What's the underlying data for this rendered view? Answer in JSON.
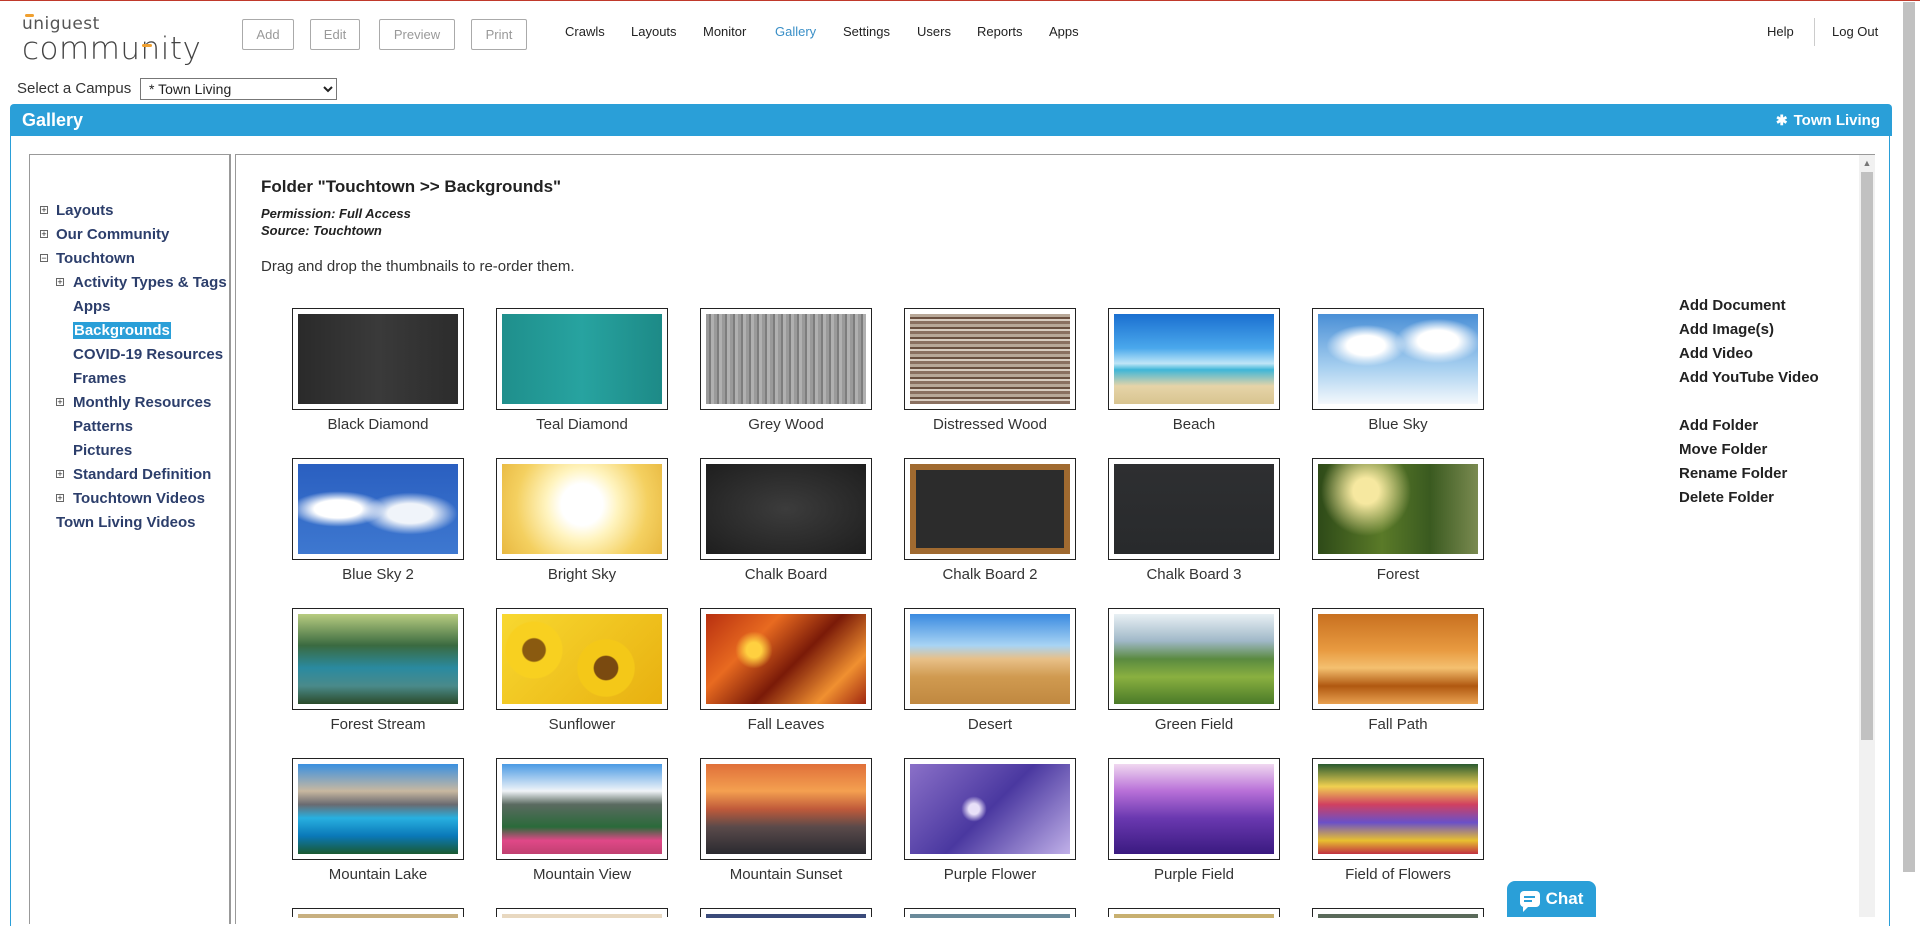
{
  "logo": {
    "line1": "uniguest",
    "line2": "community"
  },
  "toolbar": {
    "add": "Add",
    "edit": "Edit",
    "preview": "Preview",
    "print": "Print"
  },
  "nav": [
    {
      "label": "Crawls",
      "active": false
    },
    {
      "label": "Layouts",
      "active": false
    },
    {
      "label": "Monitor",
      "active": false
    },
    {
      "label": "Gallery",
      "active": true
    },
    {
      "label": "Settings",
      "active": false
    },
    {
      "label": "Users",
      "active": false
    },
    {
      "label": "Reports",
      "active": false
    },
    {
      "label": "Apps",
      "active": false
    }
  ],
  "header_right": {
    "help": "Help",
    "logout": "Log Out"
  },
  "campus": {
    "label": "Select a Campus",
    "selected": "* Town Living"
  },
  "gallery_bar": {
    "title": "Gallery",
    "campus": "Town Living"
  },
  "tree": [
    {
      "label": "Layouts",
      "expander": "+",
      "selected": false
    },
    {
      "label": "Our Community",
      "expander": "+",
      "selected": false
    },
    {
      "label": "Touchtown",
      "expander": "−",
      "selected": false
    },
    {
      "label": "Activity Types & Tags",
      "expander": "+",
      "selected": false
    },
    {
      "label": "Apps",
      "expander": "",
      "selected": false
    },
    {
      "label": "Backgrounds",
      "expander": "",
      "selected": true
    },
    {
      "label": "COVID-19 Resources",
      "expander": "",
      "selected": false
    },
    {
      "label": "Frames",
      "expander": "",
      "selected": false
    },
    {
      "label": "Monthly Resources",
      "expander": "+",
      "selected": false
    },
    {
      "label": "Patterns",
      "expander": "",
      "selected": false
    },
    {
      "label": "Pictures",
      "expander": "",
      "selected": false
    },
    {
      "label": "Standard Definition",
      "expander": "+",
      "selected": false
    },
    {
      "label": "Touchtown Videos",
      "expander": "+",
      "selected": false
    },
    {
      "label": "Town Living Videos",
      "expander": "",
      "selected": false
    }
  ],
  "folder": {
    "title": "Folder  \"Touchtown >> Backgrounds\"",
    "permission": "Permission: Full Access",
    "source": "Source: Touchtown",
    "hint": "Drag and drop the thumbnails to re-order them."
  },
  "thumbnails": [
    "Black Diamond",
    "Teal Diamond",
    "Grey Wood",
    "Distressed Wood",
    "Beach",
    "Blue Sky",
    "Blue Sky 2",
    "Bright Sky",
    "Chalk Board",
    "Chalk Board 2",
    "Chalk Board 3",
    "Forest",
    "Forest Stream",
    "Sunflower",
    "Fall Leaves",
    "Desert",
    "Green Field",
    "Fall Path",
    "Mountain Lake",
    "Mountain View",
    "Mountain Sunset",
    "Purple Flower",
    "Purple Field",
    "Field of Flowers"
  ],
  "actions": {
    "group1": [
      "Add Document",
      "Add Image(s)",
      "Add Video",
      "Add YouTube Video"
    ],
    "group2": [
      "Add Folder",
      "Move Folder",
      "Rename Folder",
      "Delete Folder"
    ]
  },
  "chat": {
    "label": "Chat"
  },
  "colors": {
    "accent": "#2a9fd8",
    "nav_active": "#3a8fc7",
    "tree_text": "#2c3e6b"
  }
}
